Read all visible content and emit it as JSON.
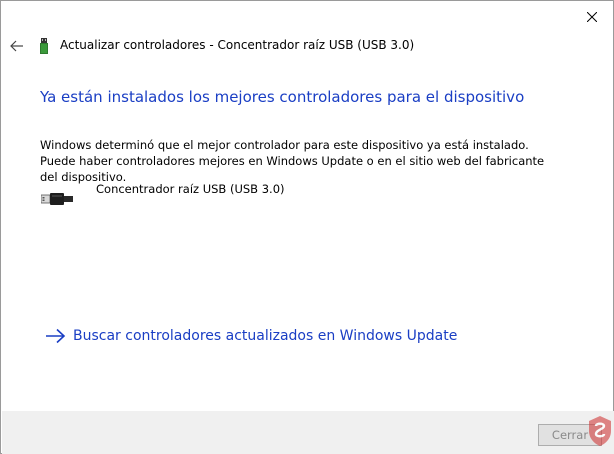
{
  "window": {
    "title": "Actualizar controladores - Concentrador raíz USB (USB 3.0)"
  },
  "main": {
    "heading": "Ya están instalados los mejores controladores para el dispositivo",
    "description": "Windows determinó que el mejor controlador para este dispositivo ya está instalado. Puede haber controladores mejores en Windows Update o en el sitio web del fabricante del dispositivo.",
    "device_name": "Concentrador raíz USB (USB 3.0)",
    "update_link_label": "Buscar controladores actualizados en Windows Update"
  },
  "footer": {
    "cancel_label": "Cerrar"
  },
  "icons": {
    "close": "close-icon",
    "back": "back-arrow-icon",
    "device": "usb-device-icon",
    "link_arrow": "arrow-right-icon"
  },
  "colors": {
    "accent_link": "#1a3ec4",
    "footer_bg": "#f0f0f0",
    "window_bg": "#ffffff"
  }
}
